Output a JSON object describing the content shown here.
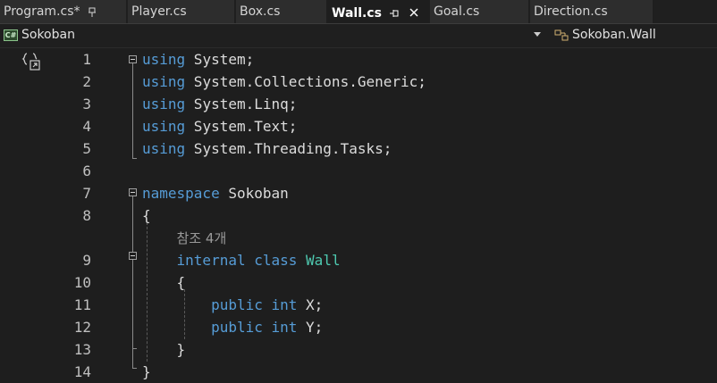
{
  "tabs": [
    {
      "label": "Program.cs*",
      "pinned": true,
      "active": false
    },
    {
      "label": "Player.cs",
      "active": false
    },
    {
      "label": "Box.cs",
      "active": false
    },
    {
      "label": "Wall.cs",
      "pinned": true,
      "active": true
    },
    {
      "label": "Goal.cs",
      "active": false
    },
    {
      "label": "Direction.cs",
      "active": false
    }
  ],
  "navbar": {
    "project_icon": "C#",
    "project": "Sokoban",
    "member": "Sokoban.Wall"
  },
  "icons": {
    "pin": "pin-icon",
    "close": "close-icon",
    "project": "csharp-project-icon",
    "class": "class-icon",
    "scope": "scope-icon",
    "fold": "collapse-icon"
  },
  "colors": {
    "keyword": "#569cd6",
    "class_name": "#4ec9b0",
    "text": "#dcdcdc",
    "codelens": "#999999",
    "background": "#1e1e1e"
  },
  "code": {
    "lines": [
      {
        "num": "1",
        "tokens": [
          {
            "t": "using",
            "c": "kw"
          },
          {
            "t": " System;",
            "c": "ns"
          }
        ]
      },
      {
        "num": "2",
        "tokens": [
          {
            "t": "using",
            "c": "kw"
          },
          {
            "t": " System.Collections.Generic;",
            "c": "ns"
          }
        ]
      },
      {
        "num": "3",
        "tokens": [
          {
            "t": "using",
            "c": "kw"
          },
          {
            "t": " System.Linq;",
            "c": "ns"
          }
        ]
      },
      {
        "num": "4",
        "tokens": [
          {
            "t": "using",
            "c": "kw"
          },
          {
            "t": " System.Text;",
            "c": "ns"
          }
        ]
      },
      {
        "num": "5",
        "tokens": [
          {
            "t": "using",
            "c": "kw"
          },
          {
            "t": " System.Threading.Tasks;",
            "c": "ns"
          }
        ]
      },
      {
        "num": "6",
        "tokens": []
      },
      {
        "num": "7",
        "tokens": [
          {
            "t": "namespace",
            "c": "kw"
          },
          {
            "t": " Sokoban",
            "c": "ns"
          }
        ]
      },
      {
        "num": "8",
        "tokens": [
          {
            "t": "{",
            "c": "ns"
          }
        ]
      },
      {
        "num": "",
        "lens": true,
        "tokens": [
          {
            "t": "    ",
            "c": "ns"
          },
          {
            "t": "참조 4개",
            "c": "lens"
          }
        ]
      },
      {
        "num": "9",
        "tokens": [
          {
            "t": "    ",
            "c": "ns"
          },
          {
            "t": "internal",
            "c": "kw"
          },
          {
            "t": " ",
            "c": "ns"
          },
          {
            "t": "class",
            "c": "kw"
          },
          {
            "t": " ",
            "c": "ns"
          },
          {
            "t": "Wall",
            "c": "cls"
          }
        ]
      },
      {
        "num": "10",
        "tokens": [
          {
            "t": "    {",
            "c": "ns"
          }
        ]
      },
      {
        "num": "11",
        "tokens": [
          {
            "t": "        ",
            "c": "ns"
          },
          {
            "t": "public",
            "c": "kw"
          },
          {
            "t": " ",
            "c": "ns"
          },
          {
            "t": "int",
            "c": "kw"
          },
          {
            "t": " X;",
            "c": "ns"
          }
        ]
      },
      {
        "num": "12",
        "tokens": [
          {
            "t": "        ",
            "c": "ns"
          },
          {
            "t": "public",
            "c": "kw"
          },
          {
            "t": " ",
            "c": "ns"
          },
          {
            "t": "int",
            "c": "kw"
          },
          {
            "t": " Y;",
            "c": "ns"
          }
        ]
      },
      {
        "num": "13",
        "tokens": [
          {
            "t": "    }",
            "c": "ns"
          }
        ]
      },
      {
        "num": "14",
        "tokens": [
          {
            "t": "}",
            "c": "ns"
          }
        ]
      }
    ]
  }
}
